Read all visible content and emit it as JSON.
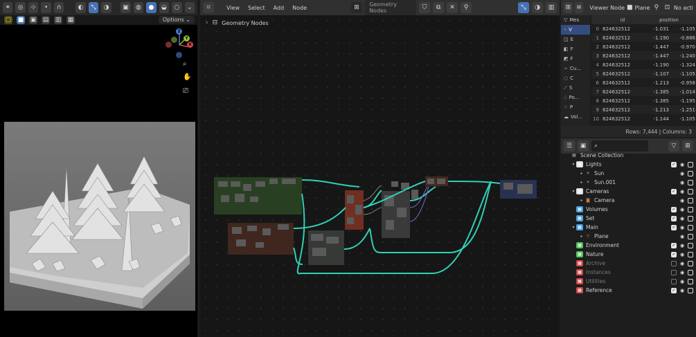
{
  "viewport": {
    "options_label": "Options",
    "gizmo": {
      "z": "Z",
      "y": "Y",
      "x": "X"
    }
  },
  "node_editor": {
    "menus": [
      "View",
      "Select",
      "Add",
      "Node"
    ],
    "tree_name": "Geometry Nodes",
    "breadcrumb": "Geometry Nodes",
    "link_color": "#2fd1b6"
  },
  "spreadsheet": {
    "viewer_label": "Viewer Node",
    "object_label": "Plane",
    "no_active": "No acti",
    "columns": [
      "id",
      "position"
    ],
    "sidebar": [
      {
        "icon": "mesh-icon",
        "label": "Mes"
      },
      {
        "icon": "vertex-icon",
        "label": "V"
      },
      {
        "icon": "edge-icon",
        "label": "E"
      },
      {
        "icon": "face-icon",
        "label": "F"
      },
      {
        "icon": "face-corner-icon",
        "label": "F"
      },
      {
        "icon": "curve-icon",
        "label": "Cu..."
      },
      {
        "icon": "control-point-icon",
        "label": "C"
      },
      {
        "icon": "spline-icon",
        "label": "S"
      },
      {
        "icon": "pointcloud-icon",
        "label": "Po..."
      },
      {
        "icon": "point-icon",
        "label": "P"
      },
      {
        "icon": "volume-icon",
        "label": "Vol..."
      }
    ],
    "rows": [
      {
        "idx": "0",
        "id": "824632512",
        "a": "-1.031",
        "b": "-1.105"
      },
      {
        "idx": "1",
        "id": "824632512",
        "a": "-1.190",
        "b": "-0.886"
      },
      {
        "idx": "2",
        "id": "824632512",
        "a": "-1.447",
        "b": "-0.970"
      },
      {
        "idx": "3",
        "id": "824632512",
        "a": "-1.447",
        "b": "-1.240"
      },
      {
        "idx": "4",
        "id": "824632512",
        "a": "-1.190",
        "b": "-1.324"
      },
      {
        "idx": "5",
        "id": "824632512",
        "a": "-1.107",
        "b": "-1.105"
      },
      {
        "idx": "6",
        "id": "824632512",
        "a": "-1.213",
        "b": "-0.958"
      },
      {
        "idx": "7",
        "id": "824632512",
        "a": "-1.385",
        "b": "-1.014"
      },
      {
        "idx": "8",
        "id": "824632512",
        "a": "-1.385",
        "b": "-1.195"
      },
      {
        "idx": "9",
        "id": "824632512",
        "a": "-1.213",
        "b": "-1.251"
      },
      {
        "idx": "10",
        "id": "824632512",
        "a": "-1.144",
        "b": "-1.105"
      }
    ],
    "footer": "Rows: 7,444  |  Columns: 3"
  },
  "outliner": {
    "root": "Scene Collection",
    "items": [
      {
        "label": "Lights",
        "depth": 1,
        "arrow": "▾",
        "icon": "collection-icon",
        "color": "#e0e0e0",
        "check": true,
        "dim": false
      },
      {
        "label": "Sun",
        "depth": 2,
        "arrow": "▸",
        "icon": "light-icon",
        "color": "#e08a3c",
        "check": false,
        "dim": false
      },
      {
        "label": "Sun.001",
        "depth": 2,
        "arrow": "▸",
        "icon": "light-icon",
        "color": "#e08a3c",
        "check": false,
        "dim": false
      },
      {
        "label": "Cameras",
        "depth": 1,
        "arrow": "▾",
        "icon": "collection-icon",
        "color": "#e0e0e0",
        "check": true,
        "dim": false
      },
      {
        "label": "Camera",
        "depth": 2,
        "arrow": "▸",
        "icon": "camera-icon",
        "color": "#e08a3c",
        "check": false,
        "dim": false
      },
      {
        "label": "Volumes",
        "depth": 1,
        "arrow": "",
        "icon": "collection-icon",
        "color": "#4a9fe0",
        "check": true,
        "dim": false
      },
      {
        "label": "Set",
        "depth": 1,
        "arrow": "",
        "icon": "collection-icon",
        "color": "#4a9fe0",
        "check": true,
        "dim": false
      },
      {
        "label": "Main",
        "depth": 1,
        "arrow": "▾",
        "icon": "collection-icon",
        "color": "#4a9fe0",
        "check": true,
        "dim": false
      },
      {
        "label": "Plane",
        "depth": 2,
        "arrow": "▸",
        "icon": "mesh-object-icon",
        "color": "#e08a3c",
        "check": false,
        "dim": false
      },
      {
        "label": "Environment",
        "depth": 1,
        "arrow": "",
        "icon": "collection-icon",
        "color": "#4fc35a",
        "check": true,
        "dim": false
      },
      {
        "label": "Nature",
        "depth": 1,
        "arrow": "",
        "icon": "collection-icon",
        "color": "#4fc35a",
        "check": true,
        "dim": false
      },
      {
        "label": "Archive",
        "depth": 1,
        "arrow": "",
        "icon": "collection-icon",
        "color": "#d04848",
        "check": false,
        "dim": true
      },
      {
        "label": "Instances",
        "depth": 1,
        "arrow": "",
        "icon": "collection-icon",
        "color": "#d04848",
        "check": false,
        "dim": true
      },
      {
        "label": "Utilities",
        "depth": 1,
        "arrow": "",
        "icon": "collection-icon",
        "color": "#d04848",
        "check": false,
        "dim": true
      },
      {
        "label": "Reference",
        "depth": 1,
        "arrow": "",
        "icon": "collection-icon",
        "color": "#d04848",
        "check": true,
        "dim": false
      }
    ]
  }
}
